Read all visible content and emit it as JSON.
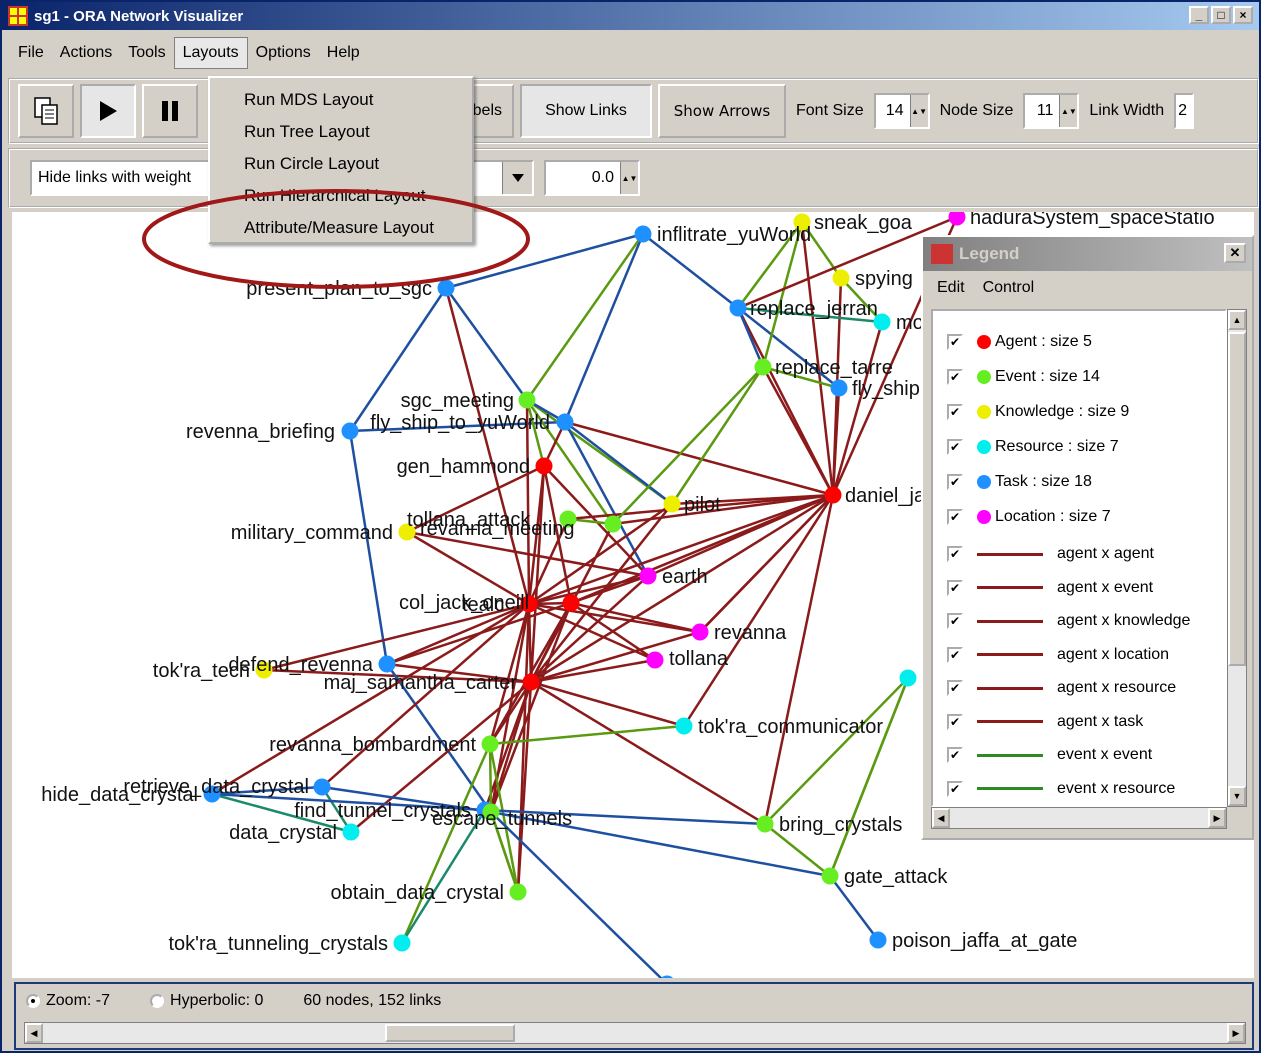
{
  "window": {
    "title": "sg1 - ORA Network Visualizer",
    "controls": [
      "_",
      "□",
      "×"
    ]
  },
  "menu": [
    "File",
    "Actions",
    "Tools",
    "Layouts",
    "Options",
    "Help"
  ],
  "layouts_menu": [
    "Run MDS Layout",
    "Run Tree Layout",
    "Run Circle Layout",
    "Run Hierarchical Layout",
    "Attribute/Measure Layout"
  ],
  "toolbar": {
    "labels_partial": "bels",
    "show_links": "Show Links",
    "show_arrows": "Show Arrows",
    "font_size_label": "Font Size",
    "font_size": "14",
    "node_size_label": "Node Size",
    "node_size": "11",
    "link_width_label": "Link Width",
    "link_width_partial": "2"
  },
  "filter": {
    "hide_links": "Hide links with weight",
    "weight_value": "0.0"
  },
  "legend": {
    "title": "Legend",
    "menu": [
      "Edit",
      "Control"
    ],
    "node_types": [
      {
        "label": "Agent : size 5",
        "color": "#ff0000"
      },
      {
        "label": "Event : size 14",
        "color": "#66ee22"
      },
      {
        "label": "Knowledge : size 9",
        "color": "#eeee00"
      },
      {
        "label": "Resource : size 7",
        "color": "#00eeee"
      },
      {
        "label": "Task : size 18",
        "color": "#1e90ff"
      },
      {
        "label": "Location : size 7",
        "color": "#ff00ff"
      }
    ],
    "link_types": [
      {
        "label": "agent x agent",
        "color": "#8b1a1a"
      },
      {
        "label": "agent x event",
        "color": "#8b1a1a"
      },
      {
        "label": "agent x knowledge",
        "color": "#8b1a1a"
      },
      {
        "label": "agent x location",
        "color": "#8b1a1a"
      },
      {
        "label": "agent x resource",
        "color": "#8b1a1a"
      },
      {
        "label": "agent x task",
        "color": "#8b1a1a"
      },
      {
        "label": "event x event",
        "color": "#2e8b22"
      },
      {
        "label": "event x resource",
        "color": "#2e8b22"
      }
    ]
  },
  "status": {
    "zoom": "Zoom: -7",
    "hyperbolic": "Hyperbolic: 0",
    "counts": "60 nodes, 152 links"
  },
  "graph": {
    "colors": {
      "agent": "#ff0000",
      "event": "#66ee22",
      "knowledge": "#eeee00",
      "resource": "#00eeee",
      "task": "#1e90ff",
      "location": "#ff00ff"
    },
    "nodes": [
      {
        "id": "infiltrate",
        "label": "inflitrate_yuWorld",
        "type": "task"
      },
      {
        "id": "present",
        "label": "present_plan_to_sgc",
        "type": "task"
      },
      {
        "id": "sgc_meeting",
        "label": "sgc_meeting",
        "type": "event"
      },
      {
        "id": "fly_ship",
        "label": "fly_ship_to_yuWorld",
        "type": "task"
      },
      {
        "id": "revenna_briefing",
        "label": "revenna_briefing",
        "type": "task"
      },
      {
        "id": "gen_hammond",
        "label": "gen_hammond",
        "type": "agent"
      },
      {
        "id": "military",
        "label": "military_command",
        "type": "knowledge"
      },
      {
        "id": "tollana_attack",
        "label": "tollana_attack",
        "type": "event"
      },
      {
        "id": "revanna_meeting",
        "label": "revanna_meeting",
        "type": "event"
      },
      {
        "id": "pilot",
        "label": "pilot",
        "type": "knowledge"
      },
      {
        "id": "earth",
        "label": "earth",
        "type": "location"
      },
      {
        "id": "col_jack",
        "label": "col_jack_oneill",
        "type": "agent"
      },
      {
        "id": "tealc",
        "label": "tealc",
        "type": "agent"
      },
      {
        "id": "revanna",
        "label": "revanna",
        "type": "location"
      },
      {
        "id": "tollana",
        "label": "tollana",
        "type": "location"
      },
      {
        "id": "defend",
        "label": "defend_revenna",
        "type": "task"
      },
      {
        "id": "tokra_tech",
        "label": "tok'ra_tech",
        "type": "knowledge"
      },
      {
        "id": "maj_carter",
        "label": "maj_samantha_carter",
        "type": "agent"
      },
      {
        "id": "tokra_comm",
        "label": "tok'ra_communicator",
        "type": "resource"
      },
      {
        "id": "bombard",
        "label": "revanna_bombardment",
        "type": "event"
      },
      {
        "id": "retrieve",
        "label": "retrieve_data_crystal",
        "type": "task"
      },
      {
        "id": "hide",
        "label": "hide_data_crystal",
        "type": "task"
      },
      {
        "id": "find_tunnel",
        "label": "find_tunnel_crystals",
        "type": "task"
      },
      {
        "id": "data_crystal",
        "label": "data_crystal",
        "type": "resource"
      },
      {
        "id": "escape",
        "label": "escape_tunnels",
        "type": "event"
      },
      {
        "id": "bring",
        "label": "bring_crystals",
        "type": "event"
      },
      {
        "id": "obtain",
        "label": "obtain_data_crystal",
        "type": "event"
      },
      {
        "id": "gate_attack",
        "label": "gate_attack",
        "type": "event"
      },
      {
        "id": "tokra_tunneling",
        "label": "tok'ra_tunneling_crystals",
        "type": "resource"
      },
      {
        "id": "poison",
        "label": "poison_jaffa_at_gate",
        "type": "task"
      },
      {
        "id": "daniel",
        "label": "daniel_jackson",
        "type": "agent"
      },
      {
        "id": "replace_jerran",
        "label": "replace_jerran",
        "type": "task"
      },
      {
        "id": "replace_tarre",
        "label": "replace_tarre",
        "type": "event"
      },
      {
        "id": "fly_ship2",
        "label": "fly_ship",
        "type": "task"
      },
      {
        "id": "sneak",
        "label": "sneak_goa",
        "type": "knowledge"
      },
      {
        "id": "spying",
        "label": "spying",
        "type": "knowledge"
      },
      {
        "id": "mo",
        "label": "mo",
        "type": "resource"
      },
      {
        "id": "hadura",
        "label": "haduraSystem_spaceStatio",
        "type": "location"
      },
      {
        "id": "right_resource",
        "label": "",
        "type": "resource"
      },
      {
        "id": "bottom_task",
        "label": "",
        "type": "task"
      }
    ],
    "edges": [
      [
        "infiltrate",
        "present",
        "task"
      ],
      [
        "infiltrate",
        "fly_ship",
        "task"
      ],
      [
        "infiltrate",
        "replace_jerran",
        "task"
      ],
      [
        "infiltrate",
        "sgc_meeting",
        "event"
      ],
      [
        "present",
        "revenna_briefing",
        "task"
      ],
      [
        "present",
        "sgc_meeting",
        "task"
      ],
      [
        "present",
        "col_jack",
        "agent"
      ],
      [
        "revenna_briefing",
        "fly_ship",
        "task"
      ],
      [
        "revenna_briefing",
        "defend",
        "task"
      ],
      [
        "sgc_meeting",
        "gen_hammond",
        "event"
      ],
      [
        "sgc_meeting",
        "col_jack",
        "agent"
      ],
      [
        "sgc_meeting",
        "revanna_meeting",
        "event"
      ],
      [
        "sgc_meeting",
        "pilot",
        "event"
      ],
      [
        "fly_ship",
        "sgc_meeting",
        "task"
      ],
      [
        "fly_ship",
        "daniel",
        "agent"
      ],
      [
        "fly_ship",
        "pilot",
        "task"
      ],
      [
        "fly_ship",
        "gen_hammond",
        "agent"
      ],
      [
        "fly_ship",
        "earth",
        "task"
      ],
      [
        "gen_hammond",
        "col_jack",
        "agent"
      ],
      [
        "gen_hammond",
        "tealc",
        "agent"
      ],
      [
        "gen_hammond",
        "maj_carter",
        "agent"
      ],
      [
        "gen_hammond",
        "military",
        "agent"
      ],
      [
        "gen_hammond",
        "earth",
        "agent"
      ],
      [
        "military",
        "col_jack",
        "agent"
      ],
      [
        "military",
        "earth",
        "agent"
      ],
      [
        "tollana_attack",
        "col_jack",
        "agent"
      ],
      [
        "tollana_attack",
        "revanna_meeting",
        "event"
      ],
      [
        "tollana_attack",
        "daniel",
        "agent"
      ],
      [
        "revanna_meeting",
        "daniel",
        "agent"
      ],
      [
        "revanna_meeting",
        "maj_carter",
        "agent"
      ],
      [
        "pilot",
        "maj_carter",
        "agent"
      ],
      [
        "pilot",
        "col_jack",
        "agent"
      ],
      [
        "pilot",
        "daniel",
        "agent"
      ],
      [
        "earth",
        "col_jack",
        "agent"
      ],
      [
        "earth",
        "maj_carter",
        "agent"
      ],
      [
        "earth",
        "daniel",
        "agent"
      ],
      [
        "earth",
        "tealc",
        "agent"
      ],
      [
        "revanna",
        "col_jack",
        "agent"
      ],
      [
        "revanna",
        "tealc",
        "agent"
      ],
      [
        "revanna",
        "maj_carter",
        "agent"
      ],
      [
        "revanna",
        "daniel",
        "agent"
      ],
      [
        "tollana",
        "col_jack",
        "agent"
      ],
      [
        "tollana",
        "tealc",
        "agent"
      ],
      [
        "tollana",
        "maj_carter",
        "agent"
      ],
      [
        "tokra_tech",
        "maj_carter",
        "agent"
      ],
      [
        "tokra_tech",
        "col_jack",
        "agent"
      ],
      [
        "defend",
        "col_jack",
        "agent"
      ],
      [
        "defend",
        "escape",
        "task"
      ],
      [
        "defend",
        "tealc",
        "agent"
      ],
      [
        "defend",
        "maj_carter",
        "agent"
      ],
      [
        "maj_carter",
        "tealc",
        "agent"
      ],
      [
        "maj_carter",
        "col_jack",
        "agent"
      ],
      [
        "maj_carter",
        "daniel",
        "agent"
      ],
      [
        "maj_carter",
        "tokra_comm",
        "agent"
      ],
      [
        "maj_carter",
        "bombard",
        "agent"
      ],
      [
        "maj_carter",
        "escape",
        "agent"
      ],
      [
        "maj_carter",
        "obtain",
        "agent"
      ],
      [
        "maj_carter",
        "find_tunnel",
        "agent"
      ],
      [
        "maj_carter",
        "bring",
        "agent"
      ],
      [
        "maj_carter",
        "data_crystal",
        "agent"
      ],
      [
        "col_jack",
        "tealc",
        "agent"
      ],
      [
        "col_jack",
        "daniel",
        "agent"
      ],
      [
        "col_jack",
        "bombard",
        "agent"
      ],
      [
        "col_jack",
        "escape",
        "agent"
      ],
      [
        "col_jack",
        "retrieve",
        "agent"
      ],
      [
        "col_jack",
        "hide",
        "agent"
      ],
      [
        "col_jack",
        "obtain",
        "agent"
      ],
      [
        "tealc",
        "daniel",
        "agent"
      ],
      [
        "tealc",
        "escape",
        "agent"
      ],
      [
        "tealc",
        "bombard",
        "agent"
      ],
      [
        "bombard",
        "tokra_comm",
        "event"
      ],
      [
        "bombard",
        "escape",
        "event"
      ],
      [
        "bombard",
        "obtain",
        "event"
      ],
      [
        "bombard",
        "tokra_tunneling",
        "event"
      ],
      [
        "retrieve",
        "hide",
        "task"
      ],
      [
        "retrieve",
        "data_crystal",
        "resource"
      ],
      [
        "retrieve",
        "escape",
        "task"
      ],
      [
        "hide",
        "data_crystal",
        "resource"
      ],
      [
        "hide",
        "find_tunnel",
        "task"
      ],
      [
        "find_tunnel",
        "escape",
        "task"
      ],
      [
        "find_tunnel",
        "bring",
        "task"
      ],
      [
        "escape",
        "gate_attack",
        "task"
      ],
      [
        "escape",
        "bottom_task",
        "task"
      ],
      [
        "escape",
        "obtain",
        "event"
      ],
      [
        "bring",
        "gate_attack",
        "event"
      ],
      [
        "bring",
        "daniel",
        "agent"
      ],
      [
        "bring",
        "right_resource",
        "event"
      ],
      [
        "gate_attack",
        "poison",
        "task"
      ],
      [
        "gate_attack",
        "right_resource",
        "event"
      ],
      [
        "daniel",
        "replace_jerran",
        "agent"
      ],
      [
        "daniel",
        "replace_tarre",
        "agent"
      ],
      [
        "daniel",
        "fly_ship2",
        "agent"
      ],
      [
        "daniel",
        "sneak",
        "agent"
      ],
      [
        "daniel",
        "spying",
        "agent"
      ],
      [
        "daniel",
        "mo",
        "agent"
      ],
      [
        "daniel",
        "hadura",
        "agent"
      ],
      [
        "daniel",
        "tokra_comm",
        "agent"
      ],
      [
        "daniel",
        "revanna",
        "agent"
      ],
      [
        "replace_jerran",
        "replace_tarre",
        "task"
      ],
      [
        "replace_jerran",
        "fly_ship2",
        "task"
      ],
      [
        "replace_jerran",
        "mo",
        "resource"
      ],
      [
        "replace_jerran",
        "sneak",
        "event"
      ],
      [
        "replace_tarre",
        "fly_ship2",
        "event"
      ],
      [
        "replace_tarre",
        "pilot",
        "event"
      ],
      [
        "replace_tarre",
        "revanna_meeting",
        "event"
      ],
      [
        "replace_tarre",
        "sneak",
        "event"
      ],
      [
        "sneak",
        "spying",
        "event"
      ],
      [
        "spying",
        "mo",
        "event"
      ],
      [
        "hadura",
        "replace_jerran",
        "agent"
      ],
      [
        "obtain",
        "escape",
        "event"
      ],
      [
        "tokra_tunneling",
        "find_tunnel",
        "resource"
      ],
      [
        "right_resource",
        "gate_attack",
        "event"
      ]
    ]
  }
}
